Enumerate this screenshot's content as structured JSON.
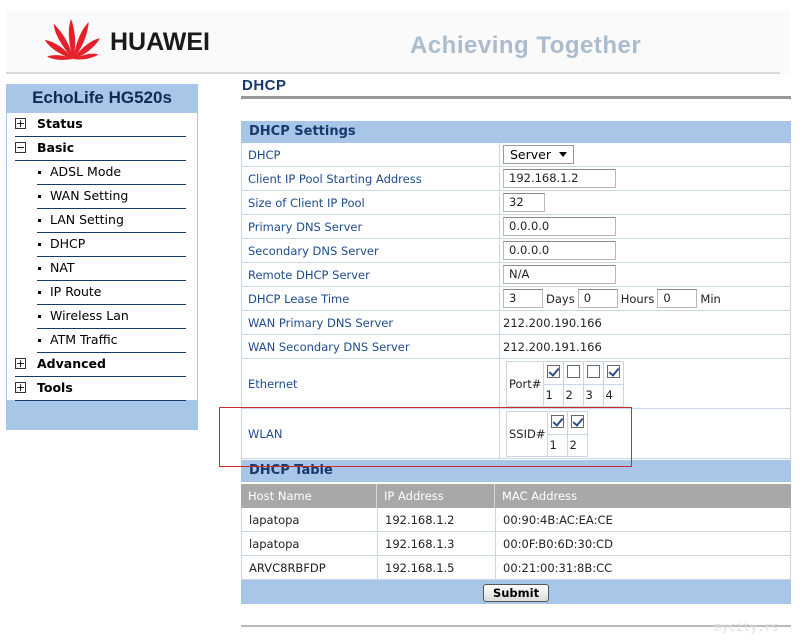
{
  "header": {
    "brand": "HUAWEI",
    "slogan": "Achieving Together",
    "logo_icon": "huawei-petal-logo",
    "logo_color": "#e4202b"
  },
  "sidebar": {
    "model": "EchoLife HG520s",
    "items": [
      {
        "label": "Status",
        "type": "group",
        "state": "collapsed",
        "icon": "plus-icon"
      },
      {
        "label": "Basic",
        "type": "group",
        "state": "expanded",
        "icon": "minus-icon"
      },
      {
        "label": "ADSL Mode",
        "type": "sub"
      },
      {
        "label": "WAN Setting",
        "type": "sub"
      },
      {
        "label": "LAN Setting",
        "type": "sub"
      },
      {
        "label": "DHCP",
        "type": "sub"
      },
      {
        "label": "NAT",
        "type": "sub"
      },
      {
        "label": "IP Route",
        "type": "sub"
      },
      {
        "label": "Wireless Lan",
        "type": "sub"
      },
      {
        "label": "ATM Traffic",
        "type": "sub"
      },
      {
        "label": "Advanced",
        "type": "group",
        "state": "collapsed",
        "icon": "plus-icon"
      },
      {
        "label": "Tools",
        "type": "group",
        "state": "collapsed",
        "icon": "plus-icon"
      }
    ]
  },
  "main": {
    "title": "DHCP",
    "settings_header": "DHCP Settings",
    "dhcp": {
      "label": "DHCP",
      "value": "Server"
    },
    "pool_start": {
      "label": "Client IP Pool Starting Address",
      "value": "192.168.1.2"
    },
    "pool_size": {
      "label": "Size of Client IP Pool",
      "value": "32"
    },
    "primary_dns": {
      "label": "Primary DNS Server",
      "value": "0.0.0.0"
    },
    "secondary_dns": {
      "label": "Secondary DNS Server",
      "value": "0.0.0.0"
    },
    "remote_dhcp": {
      "label": "Remote DHCP Server",
      "value": "N/A"
    },
    "lease": {
      "label": "DHCP Lease Time",
      "days": "3",
      "days_label": "Days",
      "hours": "0",
      "hours_label": "Hours",
      "min": "0",
      "min_label": "Min"
    },
    "wan_primary_dns": {
      "label": "WAN Primary DNS Server",
      "value": "212.200.190.166"
    },
    "wan_secondary_dns": {
      "label": "WAN Secondary DNS Server",
      "value": "212.200.191.166"
    },
    "ethernet": {
      "label": "Ethernet",
      "prefix": "Port#",
      "ports": [
        {
          "n": "1",
          "checked": true
        },
        {
          "n": "2",
          "checked": false
        },
        {
          "n": "3",
          "checked": false
        },
        {
          "n": "4",
          "checked": true
        }
      ]
    },
    "wlan": {
      "label": "WLAN",
      "prefix": "SSID#",
      "ssids": [
        {
          "n": "1",
          "checked": true
        },
        {
          "n": "2",
          "checked": true
        }
      ]
    },
    "table_header": "DHCP Table",
    "table": {
      "columns": [
        "Host Name",
        "IP Address",
        "MAC Address"
      ],
      "rows": [
        [
          "lapatopa",
          "192.168.1.2",
          "00:90:4B:AC:EA:CE"
        ],
        [
          "lapatopa",
          "192.168.1.3",
          "00:0F:B0:6D:30:CD"
        ],
        [
          "ARVC8RBFDP",
          "192.168.1.5",
          "00:21:00:31:8B:CC"
        ]
      ]
    },
    "submit_label": "Submit"
  },
  "watermark": "mycity.rs",
  "colors": {
    "accent": "#a8c6e8",
    "nav_text": "#18396c",
    "highlight": "#d02a2a"
  }
}
